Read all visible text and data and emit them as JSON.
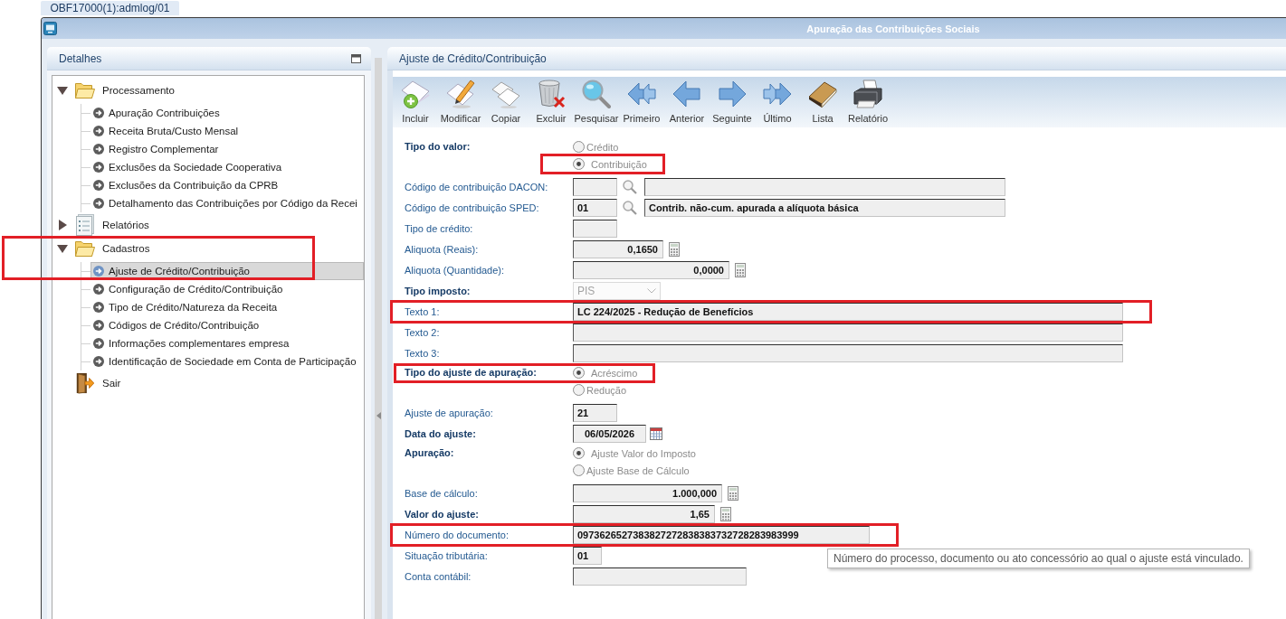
{
  "tab": {
    "label": "OBF17000(1):admlog/01"
  },
  "window": {
    "title": "Apuração das Contribuições Sociais"
  },
  "left_panel": {
    "title": "Detalhes",
    "tree": [
      {
        "label": "Processamento",
        "kind": "folder",
        "expanded": true,
        "children": [
          {
            "label": "Apuração Contribuições",
            "selected": false,
            "highlighted": false
          },
          {
            "label": "Receita Bruta/Custo Mensal",
            "selected": false,
            "highlighted": false
          },
          {
            "label": "Registro Complementar",
            "selected": false,
            "highlighted": false
          },
          {
            "label": "Exclusões da Sociedade Cooperativa",
            "selected": false,
            "highlighted": false
          },
          {
            "label": "Exclusões da Contribuição da CPRB",
            "selected": false,
            "highlighted": false
          },
          {
            "label": "Detalhamento das Contribuições por Código da Recei",
            "selected": false,
            "highlighted": false
          }
        ]
      },
      {
        "label": "Relatórios",
        "kind": "report",
        "expanded": false
      },
      {
        "label": "Cadastros",
        "kind": "folder",
        "expanded": true,
        "children": [
          {
            "label": "Ajuste de Crédito/Contribuição",
            "selected": true,
            "highlighted": true
          },
          {
            "label": "Configuração de Crédito/Contribuição",
            "selected": false,
            "highlighted": false
          },
          {
            "label": "Tipo de Crédito/Natureza da Receita",
            "selected": false,
            "highlighted": false
          },
          {
            "label": "Códigos de Crédito/Contribuição",
            "selected": false,
            "highlighted": false
          },
          {
            "label": "Informações complementares empresa",
            "selected": false,
            "highlighted": false
          },
          {
            "label": "Identificação de Sociedade em Conta de Participação",
            "selected": false,
            "highlighted": false
          }
        ]
      },
      {
        "label": "Sair",
        "kind": "exit"
      }
    ]
  },
  "right_panel": {
    "title": "Ajuste de Crédito/Contribuição",
    "toolbar": [
      {
        "label": "Incluir"
      },
      {
        "label": "Modificar"
      },
      {
        "label": "Copiar"
      },
      {
        "label": "Excluir"
      },
      {
        "label": "Pesquisar"
      },
      {
        "label": "Primeiro"
      },
      {
        "label": "Anterior"
      },
      {
        "label": "Seguinte"
      },
      {
        "label": "Último"
      },
      {
        "label": "Lista"
      },
      {
        "label": "Relatório"
      }
    ],
    "form": [
      {
        "kind": "radio_group",
        "label": "Tipo do valor:",
        "required": true,
        "disabled": true,
        "highlighted": false,
        "options": [
          {
            "label": "Crédito",
            "selected": false,
            "highlighted": false
          },
          {
            "label": "Contribuição",
            "selected": true,
            "highlighted": true
          }
        ]
      },
      {
        "kind": "lookup",
        "label": "Código de contribuição DACON:",
        "required": false,
        "highlighted": false
      },
      {
        "kind": "lookup",
        "label": "Código de contribuição SPED:",
        "required": false,
        "highlighted": false,
        "value": "01",
        "description": "Contrib. não-cum. apurada a alíquota básica"
      },
      {
        "kind": "text",
        "label": "Tipo de crédito:",
        "required": false,
        "highlighted": false
      },
      {
        "kind": "number",
        "label": "Aliquota (Reais):",
        "required": false,
        "highlighted": false,
        "value": "0,1650"
      },
      {
        "kind": "number",
        "label": "Aliquota (Quantidade):",
        "required": false,
        "highlighted": false,
        "value": "0,0000"
      },
      {
        "kind": "select",
        "label": "Tipo imposto:",
        "required": true,
        "disabled": true,
        "highlighted": false,
        "value": "PIS"
      },
      {
        "kind": "text",
        "label": "Texto 1:",
        "required": false,
        "highlighted": true,
        "value": "LC 224/2025 - Redução de Benefícios"
      },
      {
        "kind": "text",
        "label": "Texto 2:",
        "required": false,
        "highlighted": false
      },
      {
        "kind": "text",
        "label": "Texto 3:",
        "required": false,
        "highlighted": false
      },
      {
        "kind": "radio_group",
        "label": "Tipo do ajuste de apuração:",
        "required": true,
        "disabled": true,
        "highlighted": true,
        "options": [
          {
            "label": "Acréscimo",
            "selected": true,
            "highlighted": false
          },
          {
            "label": "Redução",
            "selected": false,
            "highlighted": false
          }
        ]
      },
      {
        "kind": "text",
        "label": "Ajuste de apuração:",
        "required": false,
        "highlighted": false,
        "value": "21"
      },
      {
        "kind": "date",
        "label": "Data do ajuste:",
        "required": true,
        "highlighted": false,
        "value": "06/05/2026"
      },
      {
        "kind": "radio_group",
        "label": "Apuração:",
        "required": true,
        "disabled": true,
        "highlighted": false,
        "options": [
          {
            "label": "Ajuste Valor do Imposto",
            "selected": true,
            "highlighted": false
          },
          {
            "label": "Ajuste Base de Cálculo",
            "selected": false,
            "highlighted": false
          }
        ]
      },
      {
        "kind": "number",
        "label": "Base de cálculo:",
        "required": false,
        "highlighted": false,
        "value": "1.000,000"
      },
      {
        "kind": "number",
        "label": "Valor do ajuste:",
        "required": true,
        "highlighted": false,
        "value": "1,65"
      },
      {
        "kind": "text",
        "label": "Número do documento:",
        "required": false,
        "highlighted": true,
        "value": "0973626527383827272838383732728283983999",
        "tooltip": "Número do processo, documento ou ato concessório ao qual o ajuste está vinculado."
      },
      {
        "kind": "text",
        "label": "Situação tributária:",
        "required": false,
        "highlighted": false,
        "value": "01"
      },
      {
        "kind": "text",
        "label": "Conta contábil:",
        "required": false,
        "highlighted": false
      }
    ]
  }
}
